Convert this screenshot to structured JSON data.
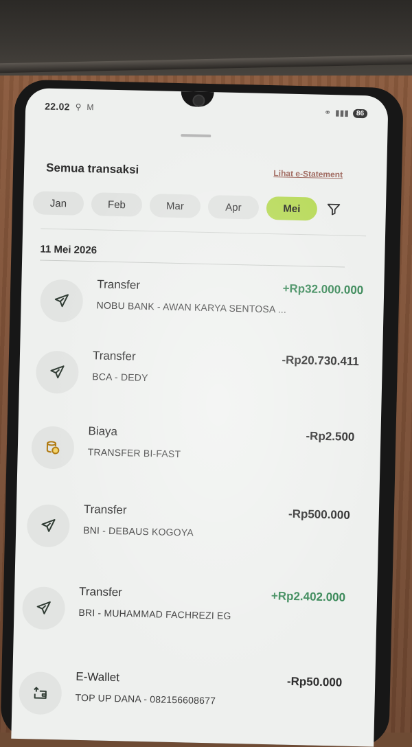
{
  "status_bar": {
    "time": "22.02",
    "icons": [
      "location-icon",
      "gmail-icon"
    ],
    "battery": "86"
  },
  "header": {
    "title": "Semua transaksi",
    "estatement_link": "Lihat e-Statement"
  },
  "months": [
    {
      "label": "Jan",
      "active": false
    },
    {
      "label": "Feb",
      "active": false
    },
    {
      "label": "Mar",
      "active": false
    },
    {
      "label": "Apr",
      "active": false
    },
    {
      "label": "Mei",
      "active": true
    }
  ],
  "date_header": "11 Mei 2026",
  "transactions": [
    {
      "icon": "send-icon",
      "type": "Transfer",
      "amount": "+Rp32.000.000",
      "direction": "in",
      "description": "NOBU BANK - AWAN KARYA SENTOSA ..."
    },
    {
      "icon": "send-icon",
      "type": "Transfer",
      "amount": "-Rp20.730.411",
      "direction": "out",
      "description": "BCA - DEDY"
    },
    {
      "icon": "coins-icon",
      "type": "Biaya",
      "amount": "-Rp2.500",
      "direction": "out",
      "description": "TRANSFER BI-FAST"
    },
    {
      "icon": "send-icon",
      "type": "Transfer",
      "amount": "-Rp500.000",
      "direction": "out",
      "description": "BNI - DEBAUS KOGOYA"
    },
    {
      "icon": "send-icon",
      "type": "Transfer",
      "amount": "+Rp2.402.000",
      "direction": "in",
      "description": "BRI - MUHAMMAD FACHREZI EG"
    },
    {
      "icon": "wallet-topup-icon",
      "type": "E-Wallet",
      "amount": "-Rp50.000",
      "direction": "out",
      "description": "TOP UP DANA - 082156608677"
    }
  ],
  "colors": {
    "accent": "#b8da5a",
    "positive": "#3c8a5a",
    "link": "#a06a60"
  }
}
